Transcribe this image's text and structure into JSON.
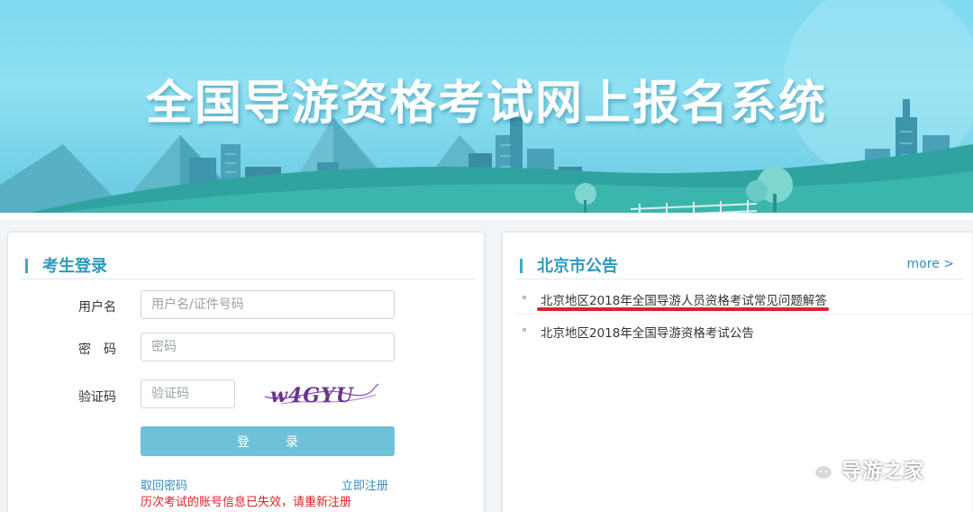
{
  "banner": {
    "title": "全国导游资格考试网上报名系统"
  },
  "login_panel": {
    "title": "考生登录",
    "username_label": "用户名",
    "username_placeholder": "用户名/证件号码",
    "password_label": "密　码",
    "password_placeholder": "密码",
    "captcha_label": "验证码",
    "captcha_placeholder": "验证码",
    "captcha_text": "w4GYU",
    "login_button": "登录",
    "recover_link": "取回密码",
    "register_link": "立即注册",
    "warning": "历次考试的账号信息已失效，请重新注册"
  },
  "notice_panel": {
    "title": "北京市公告",
    "more": "more >",
    "items": [
      {
        "text": "北京地区2018年全国导游人员资格考试常见问题解答"
      },
      {
        "text": "北京地区2018年全国导游资格考试公告"
      }
    ]
  },
  "watermark": {
    "text": "导游之家",
    "icon": "wechat-icon"
  },
  "colors": {
    "accent": "#2e9bbd",
    "button": "#6ec1d7",
    "link": "#3a8bbf",
    "warning": "#e02020",
    "highlight": "#d9232b"
  }
}
